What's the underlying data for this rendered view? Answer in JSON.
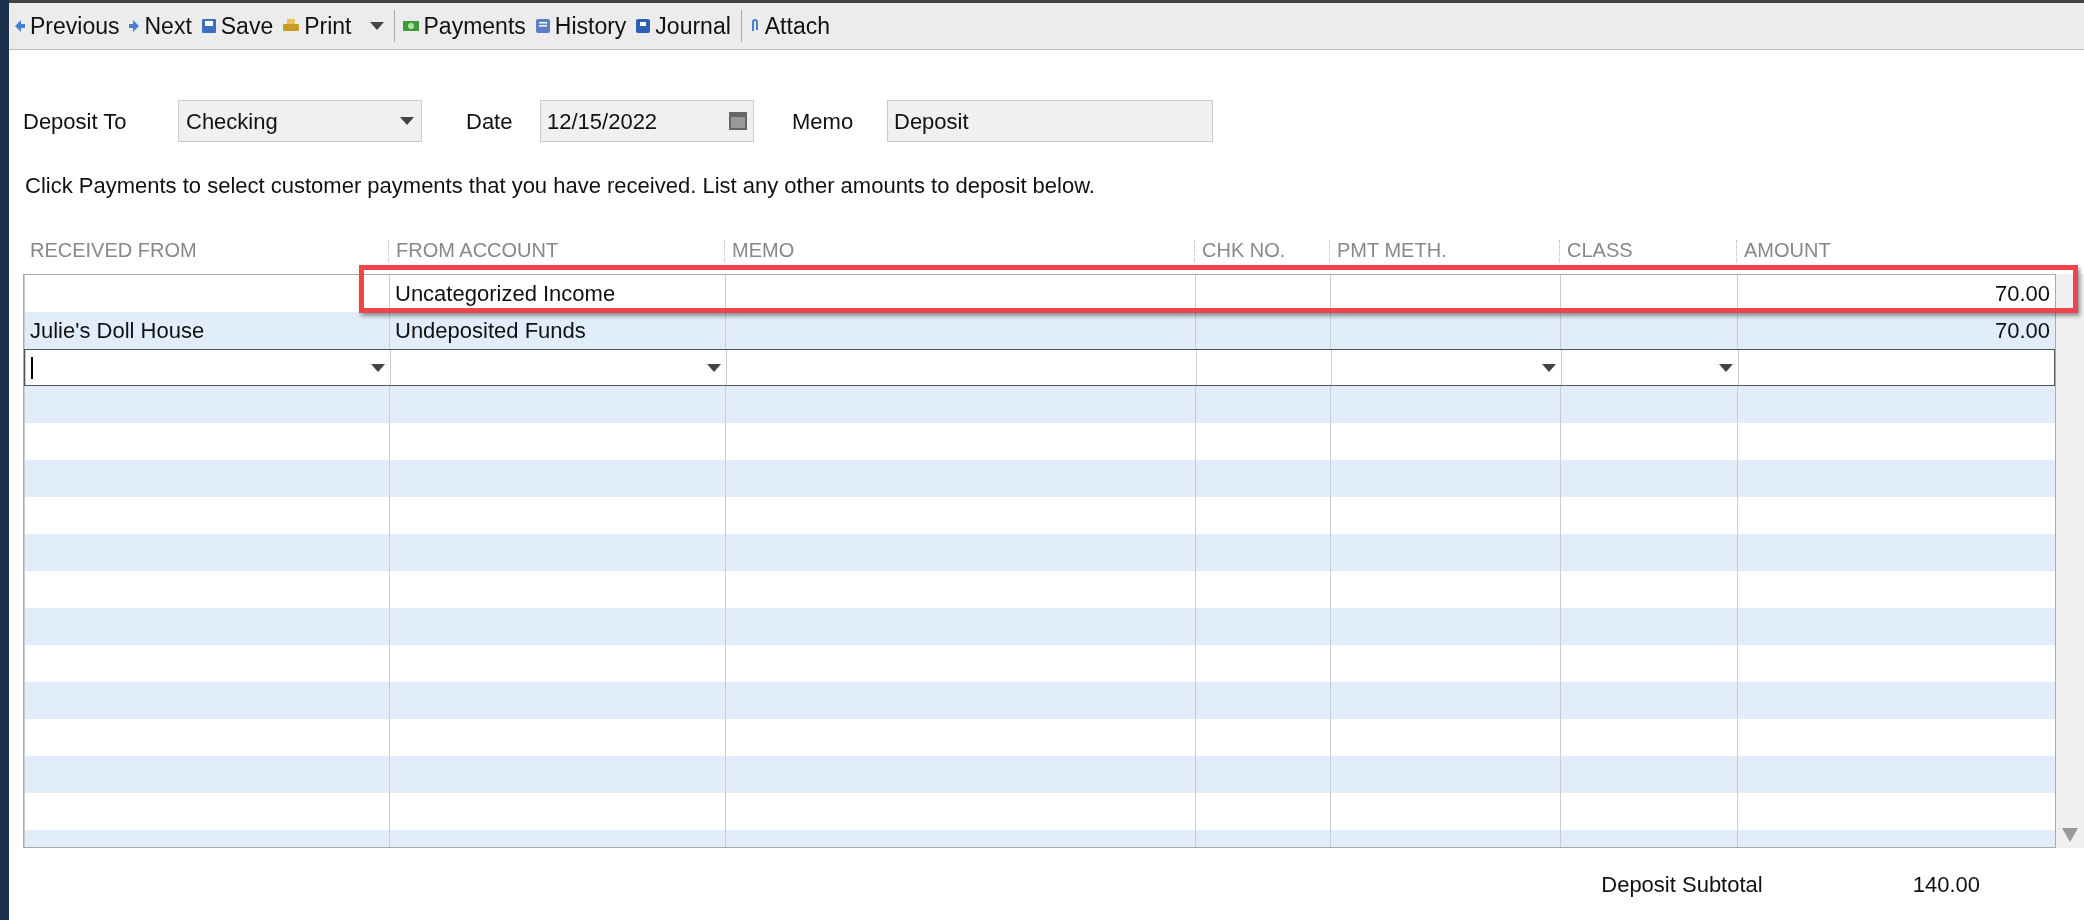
{
  "toolbar": {
    "groups": [
      [
        {
          "label": "Previous",
          "kind": "left"
        },
        {
          "label": "Next",
          "kind": "right"
        },
        {
          "label": "Save",
          "kind": "save"
        },
        {
          "label": "Print",
          "kind": "print",
          "menu": true
        }
      ],
      [
        {
          "label": "Payments",
          "kind": "money"
        },
        {
          "label": "History",
          "kind": "book"
        },
        {
          "label": "Journal",
          "kind": "journal"
        }
      ],
      [
        {
          "label": "Attach",
          "kind": "clip"
        }
      ]
    ]
  },
  "form": {
    "deposit_to": {
      "label": "Deposit To",
      "value": "Checking"
    },
    "date": {
      "label": "Date",
      "value": "12/15/2022"
    },
    "memo": {
      "label": "Memo",
      "value": "Deposit"
    }
  },
  "instructions": "Click Payments to select customer payments that you have received. List any other amounts to deposit below.",
  "table": {
    "columns": [
      {
        "label": "RECEIVED FROM",
        "dropdown": true
      },
      {
        "label": "FROM ACCOUNT",
        "dropdown": true
      },
      {
        "label": "MEMO",
        "dropdown": false
      },
      {
        "label": "CHK NO.",
        "dropdown": false
      },
      {
        "label": "PMT METH.",
        "dropdown": true
      },
      {
        "label": "CLASS",
        "dropdown": true
      },
      {
        "label": "AMOUNT",
        "dropdown": false
      }
    ],
    "rows": [
      {
        "cells": [
          "",
          "Uncategorized Income",
          "",
          "",
          "",
          "",
          "70.00"
        ],
        "highlighted": true
      },
      {
        "cells": [
          "Julie's Doll House",
          "Undeposited Funds",
          "",
          "",
          "",
          "",
          "70.00"
        ],
        "highlighted": false
      }
    ]
  },
  "subtotal": {
    "label": "Deposit Subtotal",
    "value": "140.00"
  }
}
